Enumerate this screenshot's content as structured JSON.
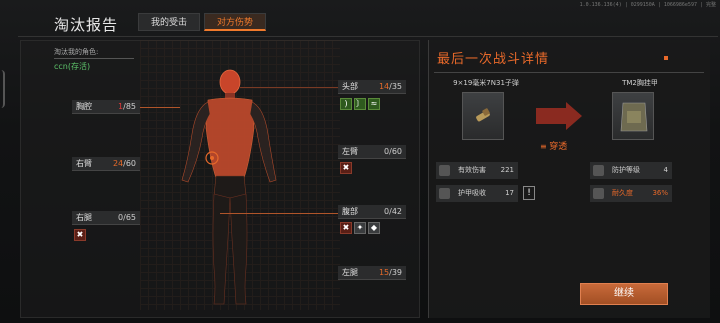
{
  "version_text": "1.0.136.136(4) | 0299150A | 1066986e597 | 完整",
  "header": {
    "title": "淘汰报告",
    "tabs": [
      {
        "label": "我的受击",
        "active": false
      },
      {
        "label": "对方伤势",
        "active": true
      }
    ]
  },
  "killer": {
    "label": "淘汰我的角色:",
    "name": "ccn(存活)"
  },
  "body_parts": {
    "chest": {
      "name": "胸腔",
      "cur": "1",
      "max": "/85"
    },
    "right_arm": {
      "name": "右臂",
      "cur": "24",
      "max": "/60"
    },
    "right_leg": {
      "name": "右腿",
      "cur": "0",
      "max": "/65"
    },
    "head": {
      "name": "头部",
      "cur": "14",
      "max": "/35"
    },
    "left_arm": {
      "name": "左臂",
      "cur": "0",
      "max": "/60"
    },
    "abdomen": {
      "name": "腹部",
      "cur": "0",
      "max": "/42"
    },
    "left_leg": {
      "name": "左腿",
      "cur": "15",
      "max": "/39"
    }
  },
  "last_fight": {
    "title": "最后一次战斗详情",
    "ammo_name": "9×19毫米7N31子弹",
    "armor_name": "TM2胸挂甲",
    "pierce_label": "穿透",
    "ammo_stats": [
      {
        "label": "有效伤害",
        "value": "221"
      },
      {
        "label": "护甲吸收",
        "value": "17"
      }
    ],
    "armor_stats": [
      {
        "label": "防护等级",
        "value": "4"
      },
      {
        "label": "耐久度",
        "value": "36%"
      }
    ],
    "warn_glyph": "!"
  },
  "continue_label": "继续",
  "colors": {
    "accent": "#e8692a",
    "alive_green": "#5dc36a",
    "critical_red": "#e23a3a"
  }
}
